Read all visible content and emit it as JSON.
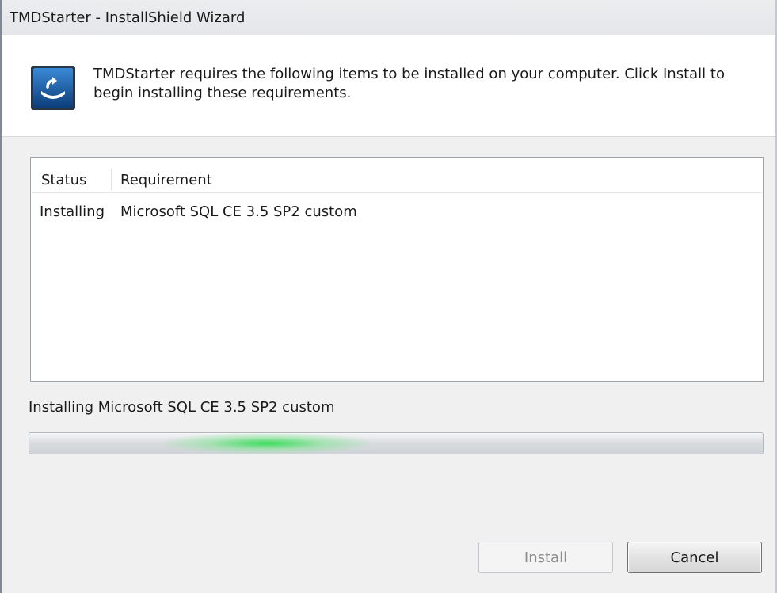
{
  "window": {
    "title": "TMDStarter - InstallShield Wizard"
  },
  "header": {
    "icon": "installer-box-icon",
    "message": "TMDStarter requires the following items to be installed on your computer. Click Install to begin installing these requirements."
  },
  "requirements": {
    "columns": [
      "Status",
      "Requirement"
    ],
    "rows": [
      {
        "status": "Installing",
        "requirement": "Microsoft SQL CE 3.5 SP2 custom"
      }
    ]
  },
  "progress": {
    "label": "Installing Microsoft SQL CE 3.5 SP2 custom",
    "mode": "marquee"
  },
  "buttons": {
    "install_label": "Install",
    "install_enabled": false,
    "cancel_label": "Cancel"
  },
  "colors": {
    "progress_glow": "#35dc56",
    "header_background": "#ffffff",
    "dialog_background": "#f0f0f0"
  }
}
